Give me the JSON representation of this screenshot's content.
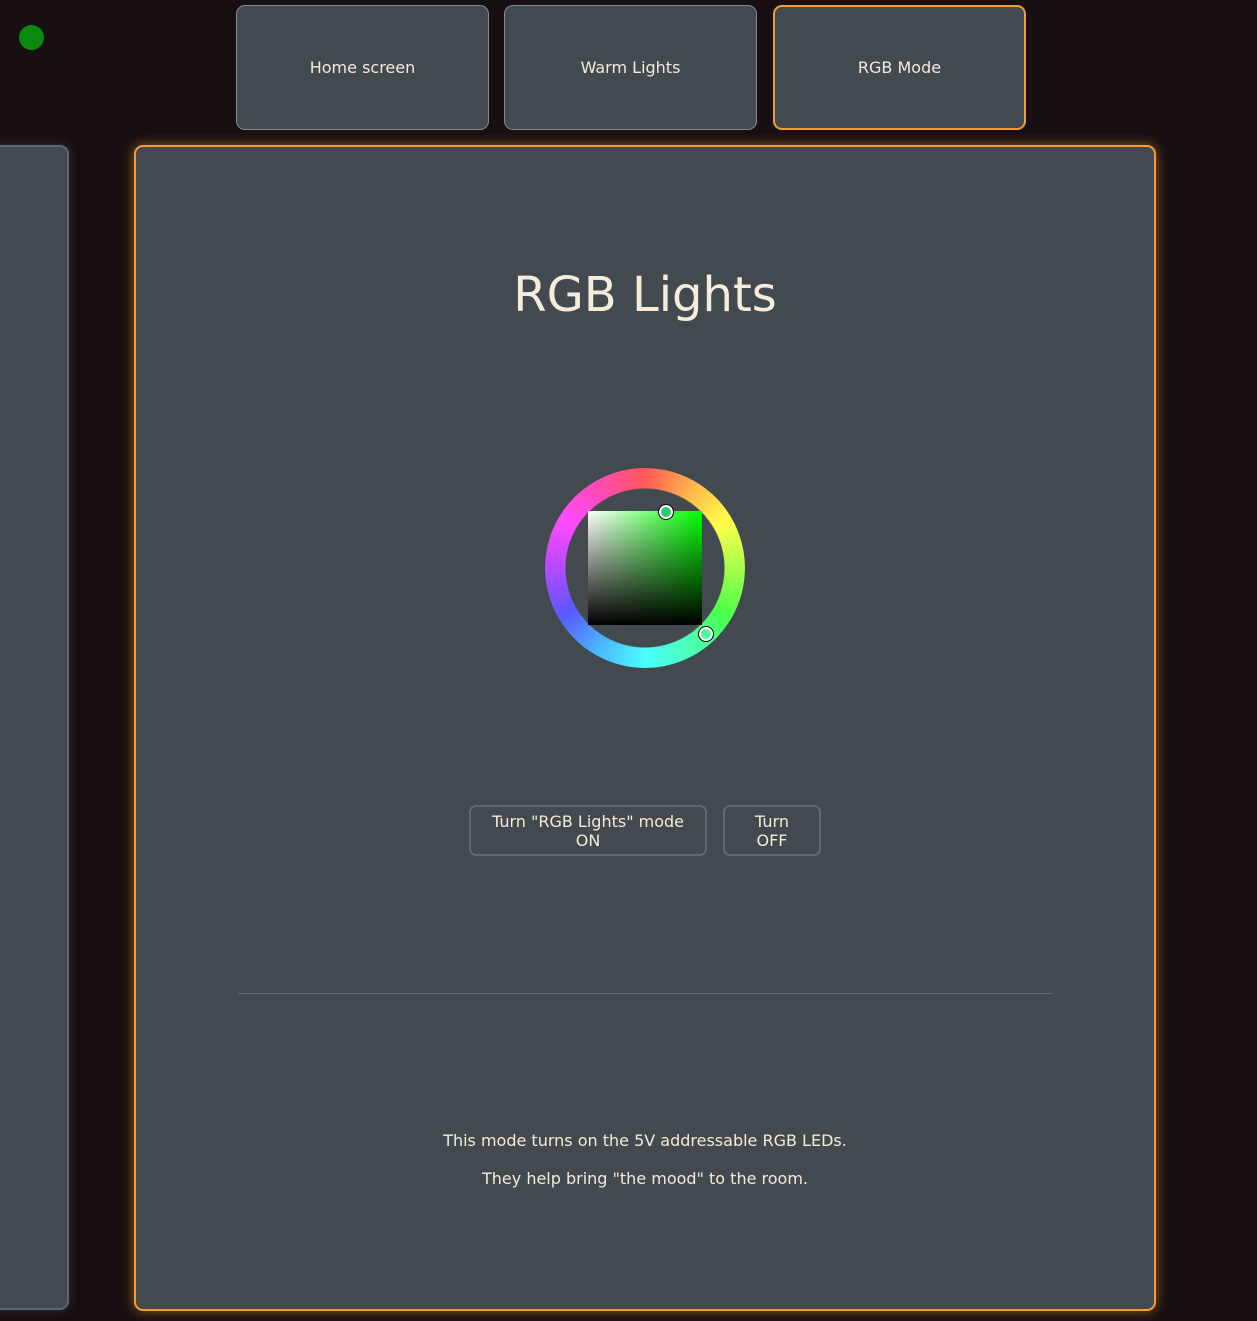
{
  "status": {
    "color": "#078a0f"
  },
  "tabs": [
    {
      "label": "Home screen",
      "active": false
    },
    {
      "label": "Warm Lights",
      "active": false
    },
    {
      "label": "RGB Mode",
      "active": true
    }
  ],
  "main": {
    "title": "RGB Lights",
    "color_picker": {
      "selected_color": "#00ff00"
    },
    "buttons": {
      "on_label": "Turn \"RGB Lights\" mode ON",
      "off_label": "Turn OFF"
    },
    "description": [
      "This mode turns on the 5V addressable RGB LEDs.",
      "They help bring \"the mood\" to the room."
    ]
  },
  "colors": {
    "accent": "#f39c2f",
    "panel": "#424a50",
    "background": "#180f12"
  }
}
